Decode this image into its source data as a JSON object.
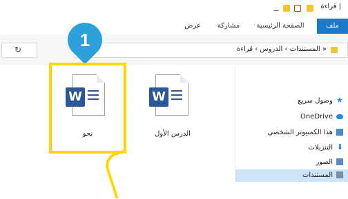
{
  "window": {
    "title": "| قراءة",
    "qat_icons": [
      "folder-icon",
      "checkbox-icon",
      "folder-icon",
      "dropdown-icon"
    ]
  },
  "ribbon": {
    "tabs": [
      "ملف",
      "الصفحة الرئيسية",
      "مشاركة",
      "عرض"
    ]
  },
  "address": {
    "path": "« المستندات › الدروس › قراءة",
    "nav_icons": [
      "back-arrow-icon",
      "forward-arrow-icon",
      "recent-dropdown-icon",
      "up-arrow-icon",
      "refresh-icon",
      "chevron-down-icon"
    ]
  },
  "sidebar": {
    "items": [
      {
        "label": "وصول سريع",
        "icon": "star-icon",
        "color": "#2e8be6"
      },
      {
        "label": "OneDrive",
        "icon": "cloud-icon",
        "color": "#1e8be6"
      },
      {
        "label": "هذا الكمبيوتر الشخصي",
        "icon": "computer-icon",
        "color": "#4a88c8"
      },
      {
        "label": "التنزيلات",
        "icon": "download-arrow-icon",
        "color": "#2b7bd0"
      },
      {
        "label": "الصور",
        "icon": "pictures-icon",
        "color": "#5b8bbf"
      },
      {
        "label": "المستندات",
        "icon": "documents-icon",
        "color": "#7a8fa6"
      }
    ]
  },
  "files": [
    {
      "name": "الدرس الأول",
      "type": "word-document"
    },
    {
      "name": "نحو",
      "type": "word-document"
    }
  ],
  "callout": {
    "number": "1",
    "badge_color": "#2fa1da",
    "highlight_color": "#ffd600"
  }
}
